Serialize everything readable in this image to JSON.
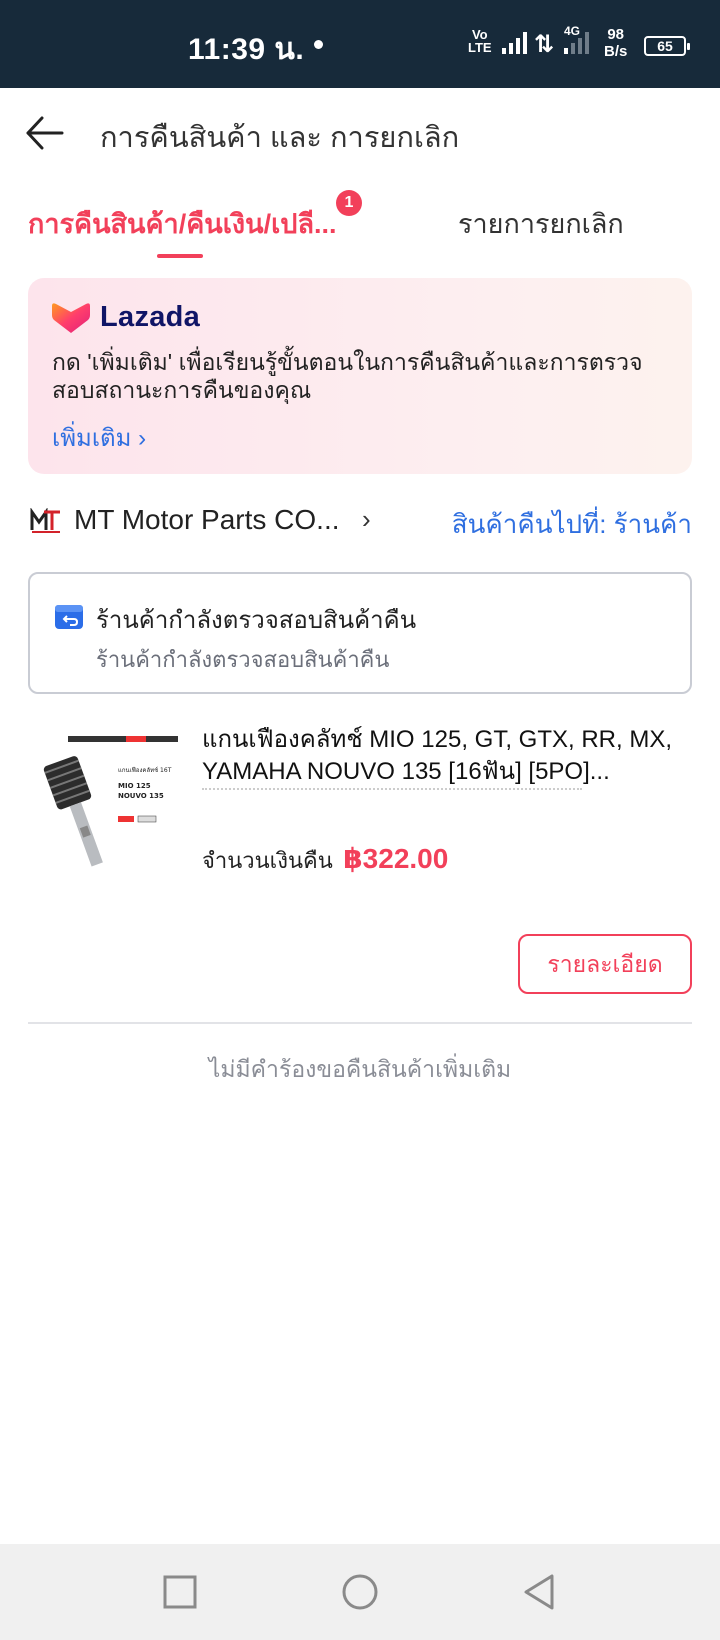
{
  "status_bar": {
    "time": "11:39 น.",
    "volte_top": "Vo",
    "volte_bottom": "LTE",
    "network_type": "4G",
    "speed_value": "98",
    "speed_unit": "B/s",
    "battery": "65"
  },
  "header": {
    "title": "การคืนสินค้า และ การยกเลิก"
  },
  "tabs": {
    "returns_label": "การคืนสินค้า/คืนเงิน/เปลี...",
    "returns_badge": "1",
    "cancel_label": "รายการยกเลิก"
  },
  "banner": {
    "brand": "Lazada",
    "text": "กด 'เพิ่มเติม' เพื่อเรียนรู้ขั้นตอนในการคืนสินค้าและการตรวจสอบสถานะการคืนของคุณ",
    "more_link": "เพิ่มเติม ›"
  },
  "shop": {
    "name": "MT Motor Parts CO...",
    "chevron": "›",
    "return_destination": "สินค้าคืนไปที่: ร้านค้า"
  },
  "status_card": {
    "title": "ร้านค้ากำลังตรวจสอบสินค้าคืน",
    "subtitle": "ร้านค้ากำลังตรวจสอบสินค้าคืน"
  },
  "product": {
    "name": "แกนเฟืองคลัทช์ MIO 125, GT, GTX, RR, MX, YAMAHA NOUVO 135 [16ฟัน] [5PO]...",
    "refund_label": "จำนวนเงินคืน",
    "refund_amount": "฿322.00",
    "image_label_line1": "แกนเฟืองคลัทช์ 16T",
    "image_label_line2": "MIO 125",
    "image_label_line3": "NOUVO 135"
  },
  "details_button": "รายละเอียด",
  "footer_note": "ไม่มีคำร้องขอคืนสินค้าเพิ่มเติม",
  "colors": {
    "accent": "#f2405a",
    "link": "#2f6fe0",
    "status_bar_bg": "#172a3a",
    "lazada_navy": "#101566"
  }
}
